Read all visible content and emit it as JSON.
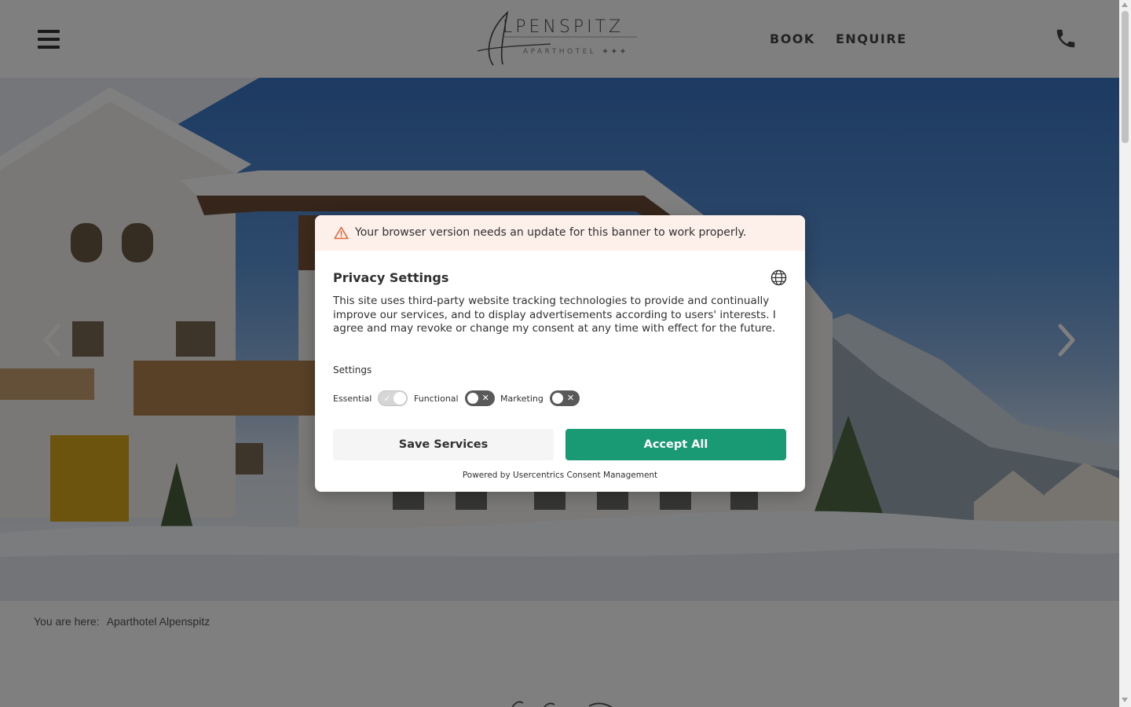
{
  "header": {
    "logo_word": "LPENSPITZ",
    "logo_initial": "A",
    "logo_sub": "APARTHOTEL",
    "logo_stars": "✦✦✦",
    "nav": {
      "book": "BOOK",
      "enquire": "ENQUIRE"
    }
  },
  "breadcrumb": {
    "label": "You are here:",
    "current": "Aparthotel Alpenspitz"
  },
  "banner": {
    "warning": "Your browser version needs an update for this banner to work properly.",
    "title": "Privacy Settings",
    "description": "This site uses third-party website tracking technologies to provide and continually improve our services, and to display advertisements according to users' interests. I agree and may revoke or change my consent at any time with effect for the future.",
    "settings_label": "Settings",
    "toggles": [
      {
        "label": "Essential",
        "state": "on-disabled",
        "mark": "✓"
      },
      {
        "label": "Functional",
        "state": "off",
        "mark": "✕"
      },
      {
        "label": "Marketing",
        "state": "off",
        "mark": "✕"
      }
    ],
    "save_label": "Save Services",
    "accept_label": "Accept All",
    "powered_prefix": "Powered by ",
    "powered_link": "Usercentrics Consent Management"
  },
  "colors": {
    "accent": "#1a9975",
    "warning_bg": "#fdf0ea",
    "warning_icon": "#e0693c",
    "overlay": "rgba(0,0,0,0.5)"
  },
  "icons": {
    "menu": "hamburger-icon",
    "phone": "phone-icon",
    "warning": "warning-triangle-icon",
    "language": "globe-icon",
    "prev": "chevron-left-icon",
    "next": "chevron-right-icon"
  }
}
